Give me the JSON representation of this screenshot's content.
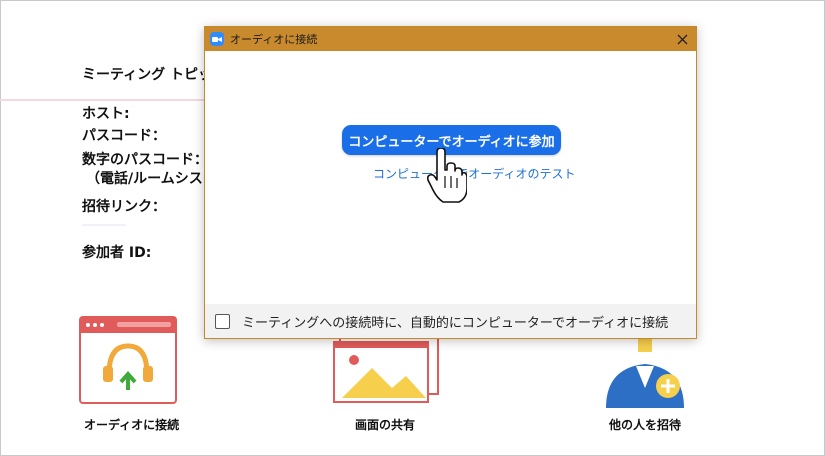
{
  "meeting_info": {
    "topic_label": "ミーティング トピック:",
    "host_label": "ホスト:",
    "passcode_label": "パスコード：",
    "numeric_passcode_label": "数字のパスコード：",
    "numeric_passcode_note": "（電話/ルームシス",
    "invite_link_label": "招待リンク：",
    "participant_id_label": "参加者 ID:"
  },
  "tiles": {
    "audio_label": "オーディオに接続",
    "share_label": "画面の共有",
    "invite_label": "他の人を招待"
  },
  "dialog": {
    "title": "オーディオに接続",
    "join_button": "コンピューターでオーディオに参加",
    "test_link": "コンピューターでオーディオのテスト",
    "auto_connect_label": "ミーティングへの接続時に、自動的にコンピューターでオーディオに接続",
    "auto_connect_checked": false,
    "close_icon": "close-icon"
  },
  "colors": {
    "titlebar": "#c98a2e",
    "primary_button": "#1a6ee8",
    "link": "#1f6fd8",
    "tile_red": "#e25b5b",
    "tile_yellow": "#f6cf4d",
    "tile_blue": "#2d6fc4"
  }
}
